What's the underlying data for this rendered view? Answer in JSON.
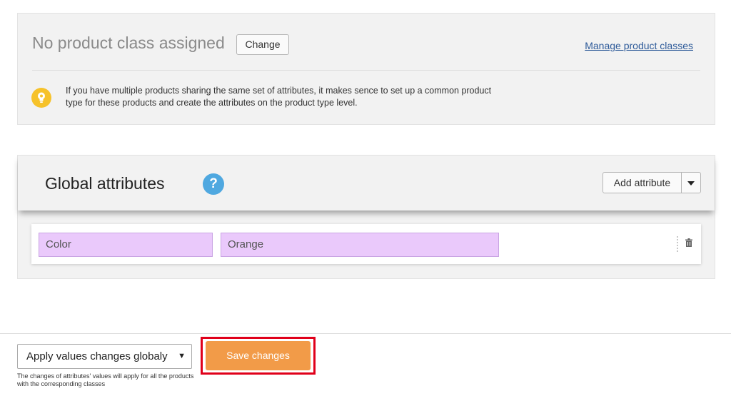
{
  "product_class": {
    "title": "No product class assigned",
    "change_label": "Change",
    "manage_link": "Manage product classes",
    "tip_text": "If you have multiple products sharing the same set of attributes, it makes sence to set up a common product type for these products and create the attributes on the product type level.",
    "tip_icon": "lightbulb-icon"
  },
  "global_attributes": {
    "title": "Global attributes",
    "help_icon": "?",
    "add_attribute_label": "Add attribute",
    "rows": [
      {
        "name": "Color",
        "value": "Orange"
      }
    ]
  },
  "footer": {
    "apply_select_value": "Apply values changes globaly",
    "apply_note": "The changes of attributes' values will apply for all the products with the corresponding classes",
    "save_label": "Save changes"
  },
  "colors": {
    "save_button": "#f29b48",
    "highlight_frame": "#e0001a",
    "attribute_field": "#eac9fb",
    "help_icon": "#4fa8e0",
    "tip_icon": "#f6c22a"
  }
}
